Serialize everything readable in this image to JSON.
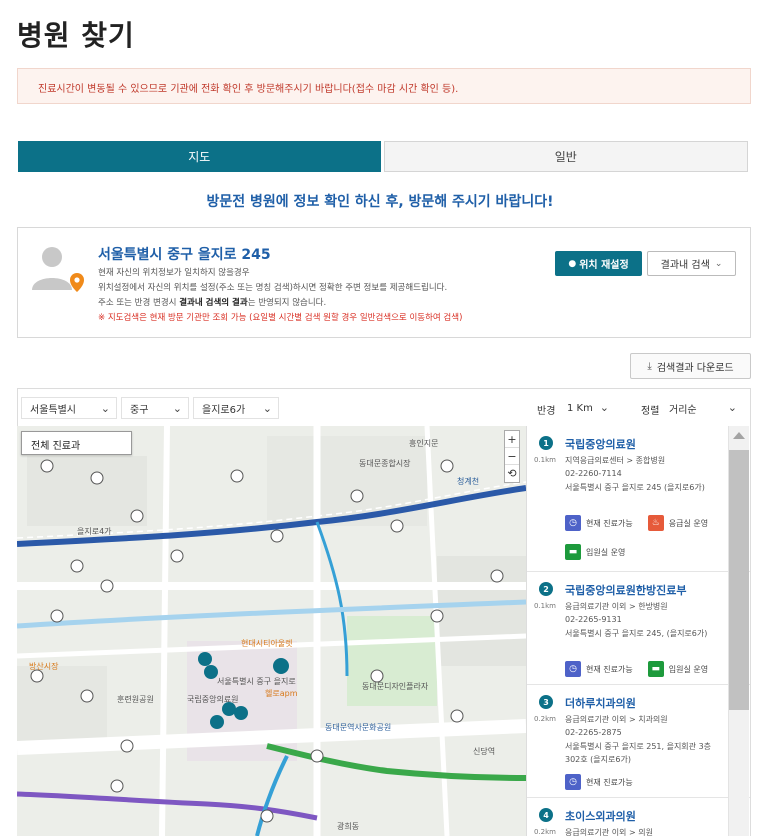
{
  "page": {
    "title": "병원 찾기"
  },
  "notice": "진료시간이 변동될 수 있으므로 기관에 전화 확인 후 방문해주시기 바랍니다(접수 마감 시간 확인 등).",
  "view_tabs": [
    {
      "label": "지도",
      "active": true
    },
    {
      "label": "일반",
      "active": false
    }
  ],
  "guide_text": "방문전 병원에 정보 확인 하신 후, 방문해 주시기 바랍니다!",
  "location": {
    "address": "서울특별시 중구 을지로 245",
    "line1": "현재 자신의 위치정보가 일치하지 않을경우",
    "line2": "위치설정에서 자신의 위치를 설정(주소 또는 명칭 검색)하시면 정확한 주변 정보를 제공해드립니다.",
    "line3_pre": "주소 또는 반경 변경시 ",
    "line3_bold": "결과내 검색의 결과",
    "line3_post": "는 반영되지 않습니다.",
    "line4": "※ 지도검색은 현재 방문 기관만 조회 가능 (요일별 시간별 검색 원할 경우 일반검색으로 이동하여 검색)",
    "reset_button": "위치 재설정",
    "search_in_button": "결과내 검색"
  },
  "download_button": "검색결과 다운로드",
  "filters": {
    "city": "서울특별시",
    "district": "중구",
    "dong": "을지로6가",
    "radius_label": "반경",
    "radius_value": "1 Km",
    "sort_label": "정렬",
    "sort_value": "거리순"
  },
  "map": {
    "dept_filter": "전체 진료과",
    "zoom_in": "+",
    "zoom_out": "−",
    "reset": "⟲",
    "labels": [
      {
        "text": "서울특별시 중구 을지로",
        "cls": ""
      },
      {
        "text": "동대문종합시장",
        "cls": ""
      },
      {
        "text": "동대문역사문화공원",
        "cls": "blue"
      },
      {
        "text": "국립중앙의료원",
        "cls": ""
      },
      {
        "text": "훈련원공원",
        "cls": ""
      },
      {
        "text": "을지로4가",
        "cls": ""
      },
      {
        "text": "헬로apm",
        "cls": "orange"
      },
      {
        "text": "동대문디자인플라자",
        "cls": ""
      },
      {
        "text": "신당역",
        "cls": ""
      },
      {
        "text": "광희동",
        "cls": ""
      },
      {
        "text": "방산시장",
        "cls": "orange"
      },
      {
        "text": "현대시티아울렛",
        "cls": "orange"
      },
      {
        "text": "청계천",
        "cls": "blue"
      },
      {
        "text": "흥인지문",
        "cls": ""
      }
    ]
  },
  "results": [
    {
      "num": "1",
      "dist": "0.1km",
      "name": "국립중앙의료원",
      "category": "지역응급의료센터 > 종합병원",
      "phone": "02-2260-7114",
      "address": "서울특별시 중구 을지로 245 (을지로6가)",
      "badges": [
        "현재 진료가능",
        "응급실 운영",
        "입원실 운영"
      ]
    },
    {
      "num": "2",
      "dist": "0.1km",
      "name": "국립중앙의료원한방진료부",
      "category": "응급의료기관 이외 > 한방병원",
      "phone": "02-2265-9131",
      "address": "서울특별시 중구 을지로 245, (을지로6가)",
      "badges": [
        "현재 진료가능",
        "입원실 운영"
      ]
    },
    {
      "num": "3",
      "dist": "0.2km",
      "name": "더하루치과의원",
      "category": "응급의료기관 이외 > 치과의원",
      "phone": "02-2265-2875",
      "address": "서울특별시 중구 을지로 251, 을지회관 3층 302호 (을지로6가)",
      "badges": [
        "현재 진료가능"
      ]
    },
    {
      "num": "4",
      "dist": "0.2km",
      "name": "초이스외과의원",
      "category": "응급의료기관 이외 > 의원",
      "phone": "",
      "address": "",
      "badges": []
    }
  ]
}
